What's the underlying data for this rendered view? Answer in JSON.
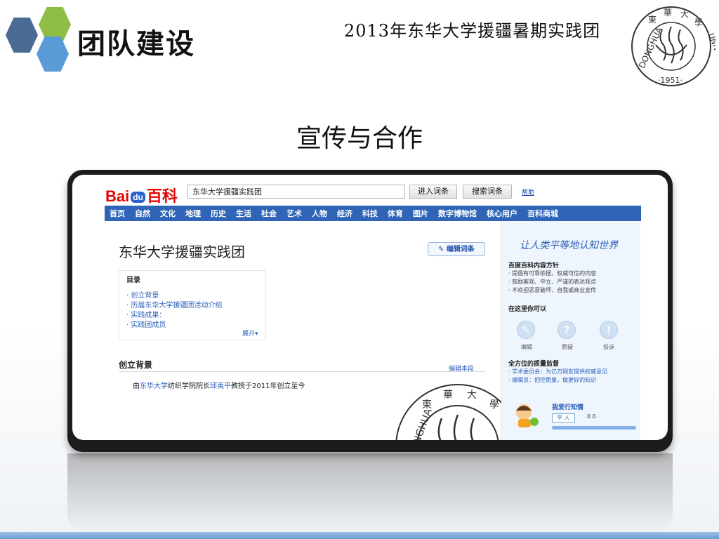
{
  "slide": {
    "title": "团队建设",
    "team_name": "2013年东华大学援疆暑期实践团",
    "section_title": "宣传与合作",
    "seal": {
      "text_top": "東 華 大 學",
      "text_left": "DONGHUA",
      "text_right": "UNIVERSITY",
      "year": "·1951·"
    }
  },
  "baidu": {
    "logo_left": "Bai",
    "logo_paw": "du",
    "logo_right": "百科",
    "search_value": "东华大学援疆实践团",
    "enter_button": "进入词条",
    "search_button": "搜索词条",
    "help_link": "帮助",
    "nav": [
      "首页",
      "自然",
      "文化",
      "地理",
      "历史",
      "生活",
      "社会",
      "艺术",
      "人物",
      "经济",
      "科技",
      "体育",
      "图片",
      "数字博物馆",
      "核心用户",
      "百科商城"
    ]
  },
  "article": {
    "title": "东华大学援疆实践团",
    "edit_button": "编辑词条",
    "toc_title": "目录",
    "toc_items": [
      "· 创立背景",
      "· 历届东华大学援疆团活动介绍",
      "· 实践成果：",
      "· 实践团成员"
    ],
    "toc_expand": "展开▾",
    "section_heading": "创立背景",
    "section_edit": "编辑本段",
    "para_prefix": "由",
    "para_link1": "东华大学",
    "para_mid": "纺织学院院长",
    "para_link2": "邱夷平",
    "para_suffix": "教授于2011年创立至今"
  },
  "sidebar": {
    "slogan": "让人类平等地认知世界",
    "policy_title": "百度百科内容方针",
    "policy_lines": [
      "· 提倡有可靠依据、权威可信的内容",
      "· 鼓励客观、中立、严谨的表达观点",
      "· 不欢迎恶意破坏、自我或商业宣传"
    ],
    "can_do_title": "在这里你可以",
    "actions": [
      "编辑",
      "质疑",
      "投诉"
    ],
    "quality_title": "全方位的质量监督",
    "quality_lines": [
      "· 学术委员会：为亿万网友提供权威意见",
      "· 编辑员：把控质量，做更好的知识"
    ],
    "user_title": "我爱行知情",
    "user_rank": "平 人",
    "user_counts": "0 0"
  }
}
